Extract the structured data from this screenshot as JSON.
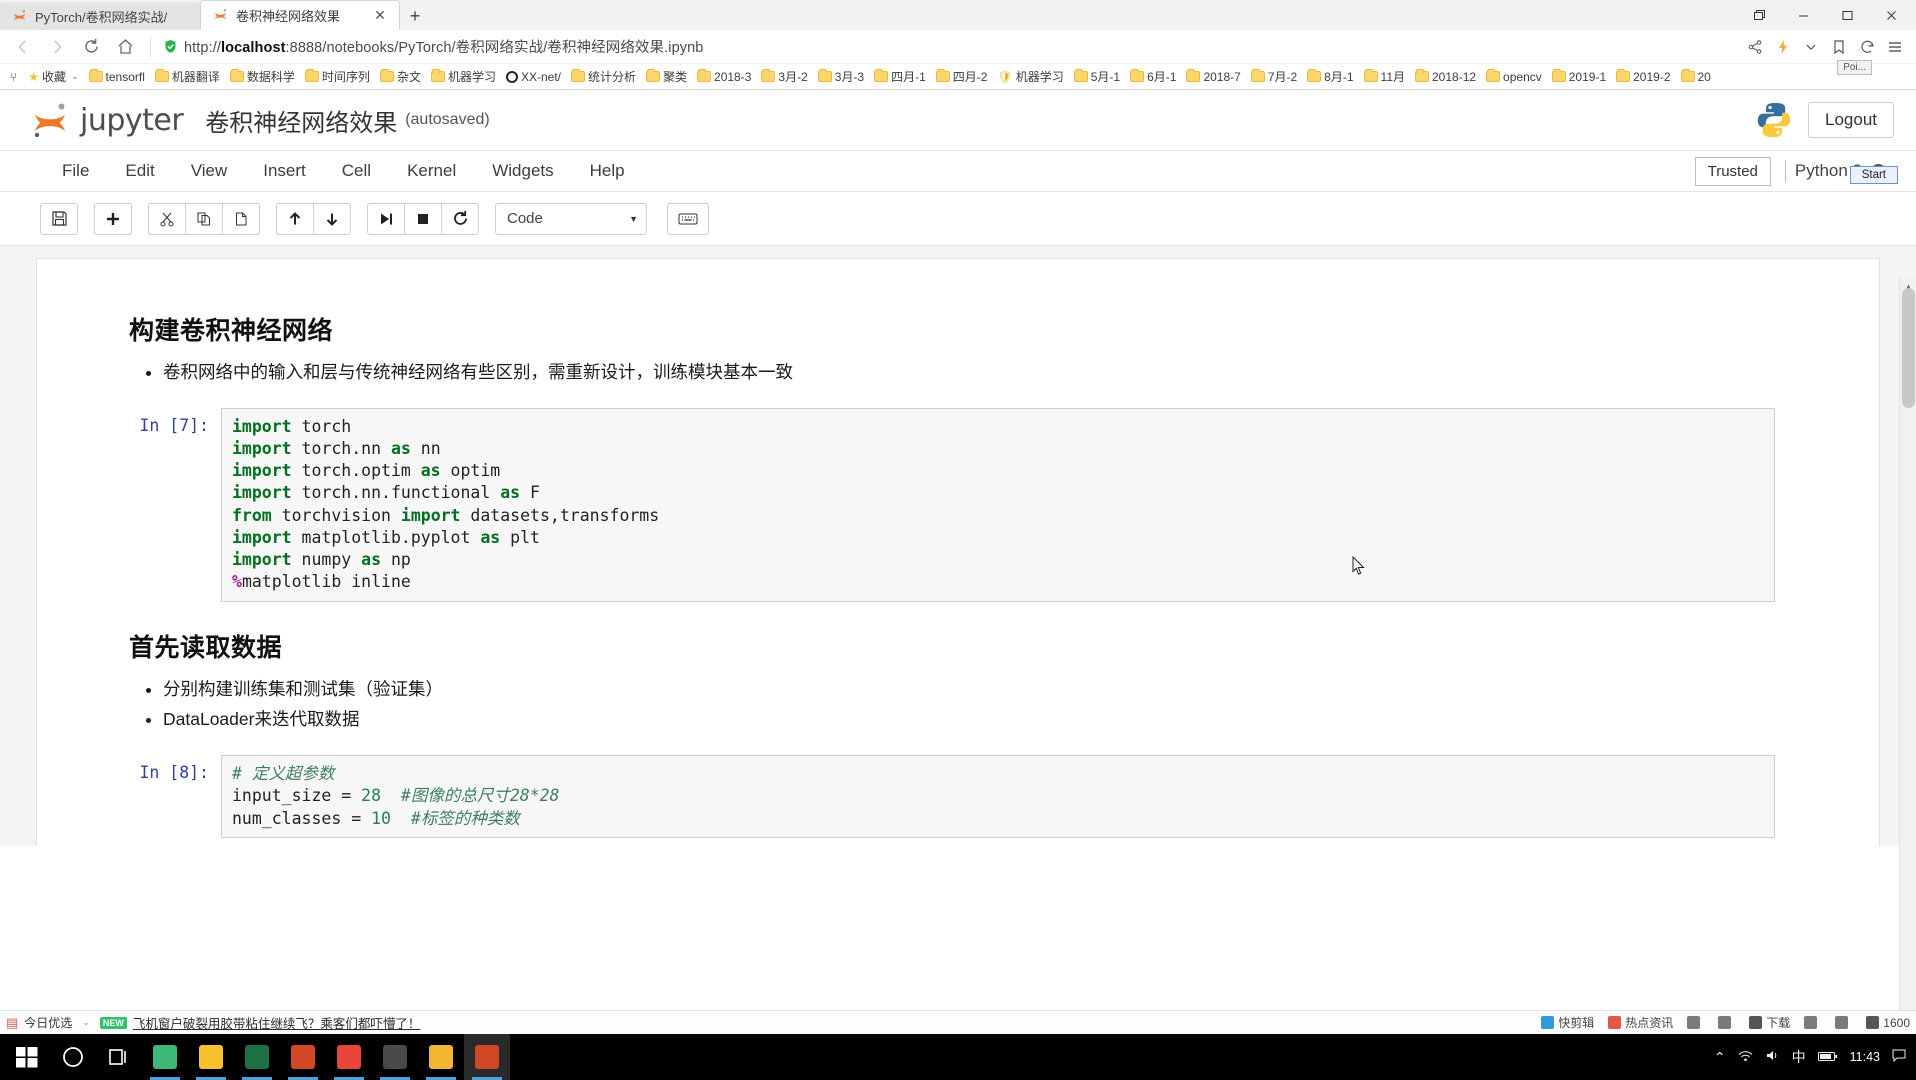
{
  "browser": {
    "tabs": [
      {
        "title": "PyTorch/卷积网络实战/",
        "active": false,
        "favicon": "jupyter-icon"
      },
      {
        "title": "卷积神经网络效果",
        "active": true,
        "favicon": "jupyter-icon",
        "close": "✕"
      }
    ],
    "newtab_label": "+",
    "window_controls": [
      "restore-down",
      "minimize",
      "maximize",
      "close"
    ],
    "nav": {
      "back": "‹",
      "forward": "›",
      "reload": "⟳",
      "home": "⌂"
    },
    "url": {
      "scheme": "http://",
      "host": "localhost",
      "rest": ":8888/notebooks/PyTorch/卷积网络实战/卷积神经网络效果.ipynb",
      "full": "http://localhost:8888/notebooks/PyTorch/卷积网络实战/卷积神经网络效果.ipynb"
    },
    "addr_actions": [
      "share-icon",
      "lightning-icon",
      "chevron-down-icon",
      "bookmark-icon",
      "history-icon",
      "menu-icon"
    ],
    "bookmarks_overflow": "⑂",
    "bookmarks": [
      {
        "label": "收藏",
        "icon": "star-icon",
        "caret": "⌄"
      },
      {
        "label": "tensorfl",
        "icon": "folder-icon"
      },
      {
        "label": "机器翻译",
        "icon": "folder-icon"
      },
      {
        "label": "数据科学",
        "icon": "folder-icon"
      },
      {
        "label": "时间序列",
        "icon": "folder-icon"
      },
      {
        "label": "杂文",
        "icon": "folder-icon"
      },
      {
        "label": "机器学习",
        "icon": "folder-icon"
      },
      {
        "label": "XX-net/",
        "icon": "circle-icon"
      },
      {
        "label": "统计分析",
        "icon": "folder-icon"
      },
      {
        "label": "聚类",
        "icon": "folder-icon"
      },
      {
        "label": "2018-3",
        "icon": "folder-icon"
      },
      {
        "label": "3月-2",
        "icon": "folder-icon"
      },
      {
        "label": "3月-3",
        "icon": "folder-icon"
      },
      {
        "label": "四月-1",
        "icon": "folder-icon"
      },
      {
        "label": "四月-2",
        "icon": "folder-icon"
      },
      {
        "label": "机器学习",
        "icon": "shield-icon"
      },
      {
        "label": "5月-1",
        "icon": "folder-icon"
      },
      {
        "label": "6月-1",
        "icon": "folder-icon"
      },
      {
        "label": "2018-7",
        "icon": "folder-icon"
      },
      {
        "label": "7月-2",
        "icon": "folder-icon"
      },
      {
        "label": "8月-1",
        "icon": "folder-icon"
      },
      {
        "label": "11月",
        "icon": "folder-icon"
      },
      {
        "label": "2018-12",
        "icon": "folder-icon"
      },
      {
        "label": "opencv",
        "icon": "folder-icon"
      },
      {
        "label": "2019-1",
        "icon": "folder-icon"
      },
      {
        "label": "2019-2",
        "icon": "folder-icon"
      },
      {
        "label": "20",
        "icon": "folder-icon"
      }
    ],
    "tooltip": "Poi..."
  },
  "jupyter": {
    "brand": "jupyter",
    "notebook_title": "卷积神经网络效果",
    "save_state": "(autosaved)",
    "logout_label": "Logout",
    "start_tooltip": "Start",
    "menus": [
      "File",
      "Edit",
      "View",
      "Insert",
      "Cell",
      "Kernel",
      "Widgets",
      "Help"
    ],
    "trusted_label": "Trusted",
    "kernel_name": "Python 3",
    "toolbar": {
      "groups": [
        [
          "save-icon"
        ],
        [
          "add-cell-icon"
        ],
        [
          "cut-icon",
          "copy-icon",
          "paste-icon"
        ],
        [
          "move-up-icon",
          "move-down-icon"
        ],
        [
          "run-cell-icon",
          "interrupt-kernel-icon",
          "restart-kernel-icon"
        ]
      ],
      "cell_type": "Code",
      "cell_type_caret": "▼",
      "keyboard_button": "keyboard-icon"
    }
  },
  "notebook": {
    "cells": [
      {
        "kind": "markdown",
        "heading": "构建卷积神经网络",
        "bullets": [
          "卷积网络中的输入和层与传统神经网络有些区别，需重新设计，训练模块基本一致"
        ]
      },
      {
        "kind": "code",
        "prompt": "In [7]:",
        "lines": [
          [
            {
              "t": "import",
              "c": "k"
            },
            {
              "t": " torch",
              "c": "n"
            }
          ],
          [
            {
              "t": "import",
              "c": "k"
            },
            {
              "t": " torch.nn ",
              "c": "n"
            },
            {
              "t": "as",
              "c": "k"
            },
            {
              "t": " nn",
              "c": "n"
            }
          ],
          [
            {
              "t": "import",
              "c": "k"
            },
            {
              "t": " torch.optim ",
              "c": "n"
            },
            {
              "t": "as",
              "c": "k"
            },
            {
              "t": " optim",
              "c": "n"
            }
          ],
          [
            {
              "t": "import",
              "c": "k"
            },
            {
              "t": " torch.nn.functional ",
              "c": "n"
            },
            {
              "t": "as",
              "c": "k"
            },
            {
              "t": " F",
              "c": "n"
            }
          ],
          [
            {
              "t": "from",
              "c": "k"
            },
            {
              "t": " torchvision ",
              "c": "n"
            },
            {
              "t": "import",
              "c": "k"
            },
            {
              "t": " datasets,transforms",
              "c": "n"
            }
          ],
          [
            {
              "t": "import",
              "c": "k"
            },
            {
              "t": " matplotlib.pyplot ",
              "c": "n"
            },
            {
              "t": "as",
              "c": "k"
            },
            {
              "t": " plt",
              "c": "n"
            }
          ],
          [
            {
              "t": "import",
              "c": "k"
            },
            {
              "t": " numpy ",
              "c": "n"
            },
            {
              "t": "as",
              "c": "k"
            },
            {
              "t": " np",
              "c": "n"
            }
          ],
          [
            {
              "t": "%",
              "c": "magic"
            },
            {
              "t": "matplotlib inline",
              "c": "n"
            }
          ]
        ]
      },
      {
        "kind": "markdown",
        "heading": "首先读取数据",
        "bullets": [
          "分别构建训练集和测试集（验证集）",
          "DataLoader来迭代取数据"
        ]
      },
      {
        "kind": "code",
        "prompt": "In [8]:",
        "lines": [
          [
            {
              "t": "# 定义超参数",
              "c": "cmt"
            }
          ],
          [
            {
              "t": "input_size = ",
              "c": "n"
            },
            {
              "t": "28",
              "c": "num"
            },
            {
              "t": "  ",
              "c": "n"
            },
            {
              "t": "#图像的总尺寸28*28",
              "c": "cmt"
            }
          ],
          [
            {
              "t": "num_classes = ",
              "c": "n"
            },
            {
              "t": "10",
              "c": "num"
            },
            {
              "t": "  ",
              "c": "n"
            },
            {
              "t": "#标签的种类数",
              "c": "cmt"
            }
          ]
        ]
      }
    ]
  },
  "statusbar": {
    "promo_label": "今日优选",
    "promo_caret": "⌄",
    "badge": "NEW",
    "promo_text": "飞机窗户破裂用胶带粘住继续飞？乘客们都吓懵了！",
    "right_items": [
      {
        "label": "快剪辑",
        "icon": "scissors-icon",
        "color": "#2f9bd8"
      },
      {
        "label": "热点资讯",
        "icon": "news-icon",
        "color": "#e05a43"
      },
      {
        "label": "",
        "icon": "image-icon",
        "color": "#7a7a7a"
      },
      {
        "label": "",
        "icon": "screenshot-icon",
        "color": "#7a7a7a"
      },
      {
        "label": "下载",
        "icon": "download-icon",
        "color": "#555"
      },
      {
        "label": "",
        "icon": "window-icon",
        "color": "#7a7a7a"
      },
      {
        "label": "",
        "icon": "plugin-icon",
        "color": "#7a7a7a"
      },
      {
        "label": "1600",
        "icon": "zoom-icon",
        "color": "#555"
      }
    ]
  },
  "taskbar": {
    "items": [
      {
        "name": "start-button",
        "icon": "windows-logo",
        "color": "#ffffff"
      },
      {
        "name": "cortana-button",
        "icon": "circle-icon",
        "color": "#ffffff"
      },
      {
        "name": "task-view-button",
        "icon": "taskview-icon",
        "color": "#ffffff"
      },
      {
        "name": "edge-browser",
        "icon": "edge-icon",
        "color": "#3cb878"
      },
      {
        "name": "file-explorer",
        "icon": "folder-icon",
        "color": "#fbc02d"
      },
      {
        "name": "excel-app",
        "icon": "excel-icon",
        "color": "#1d7044"
      },
      {
        "name": "powerpoint-app",
        "icon": "ppt-icon",
        "color": "#d24726"
      },
      {
        "name": "pdf-app",
        "icon": "pdf-icon",
        "color": "#e8453c"
      },
      {
        "name": "notes-app",
        "icon": "notes-icon",
        "color": "#4a4a4a"
      },
      {
        "name": "paint-app",
        "icon": "paint-icon",
        "color": "#f2b632"
      },
      {
        "name": "chrome-browser",
        "icon": "browser-icon",
        "color": "#d24726"
      }
    ],
    "tray": {
      "chevron": "⌃",
      "icons": [
        "network-icon",
        "volume-icon",
        "ime-icon",
        "battery-icon"
      ],
      "ime_label": "中",
      "time": "11:43",
      "date": ""
    }
  }
}
